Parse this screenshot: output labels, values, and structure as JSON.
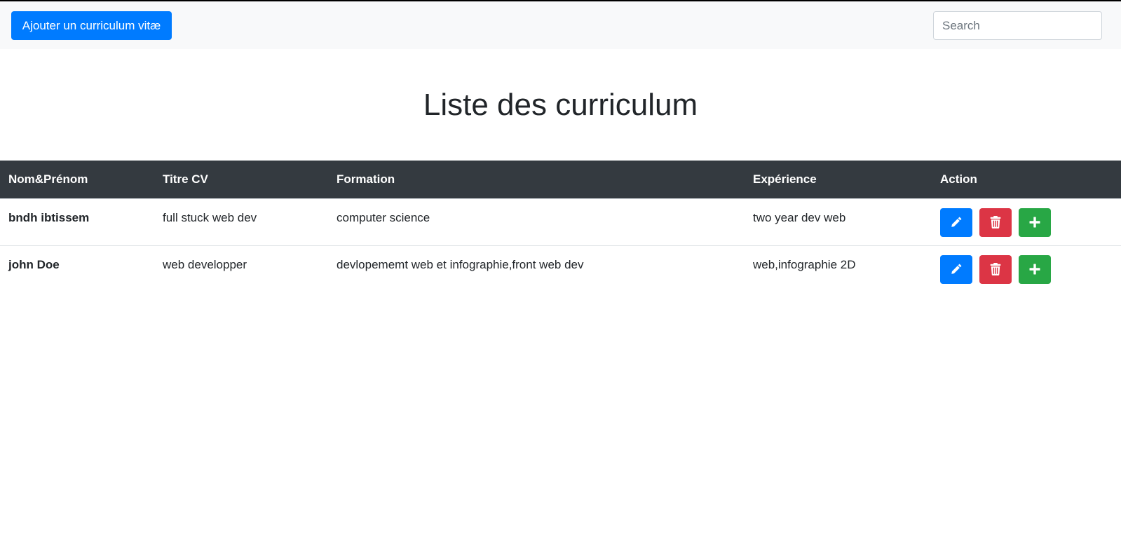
{
  "navbar": {
    "add_button_label": "Ajouter un curriculum vitæ",
    "search_placeholder": "Search"
  },
  "page": {
    "title": "Liste des curriculum"
  },
  "table": {
    "headers": [
      "Nom&Prénom",
      "Titre CV",
      "Formation",
      "Expérience",
      "Action"
    ],
    "rows": [
      {
        "name": "bndh ibtissem",
        "title": "full stuck web dev",
        "formation": "computer science",
        "experience": "two year dev web"
      },
      {
        "name": "john Doe",
        "title": "web developper",
        "formation": "devlopememt web et infographie,front web dev",
        "experience": "web,infographie 2D"
      }
    ],
    "action_icons": [
      "pencil-icon",
      "trash-icon",
      "plus-icon"
    ]
  },
  "colors": {
    "primary": "#007bff",
    "danger": "#dc3545",
    "success": "#28a745",
    "table_header": "#343a40",
    "navbar_bg": "#f8f9fa"
  }
}
